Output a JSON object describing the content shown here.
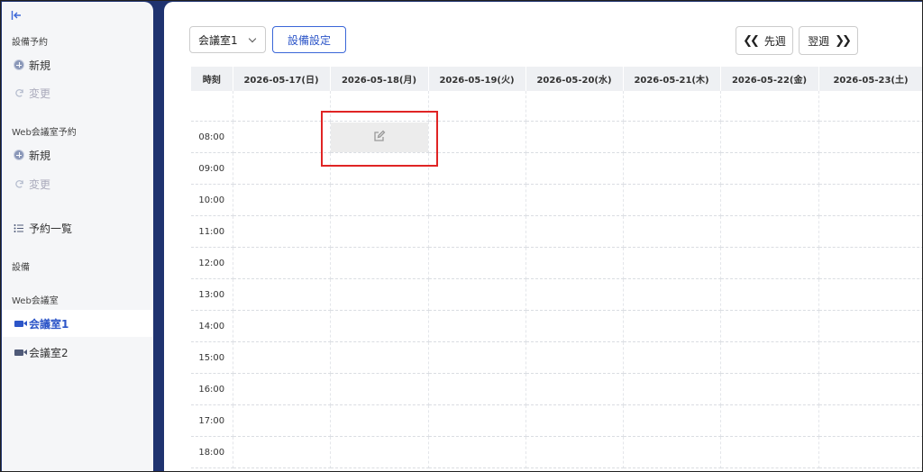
{
  "sidebar": {
    "facility_reservation_label": "設備予約",
    "facility_new": "新規",
    "facility_change": "変更",
    "web_reservation_label": "Web会議室予約",
    "web_new": "新規",
    "web_change": "変更",
    "reservation_list": "予約一覧",
    "facility_label": "設備",
    "web_room_label": "Web会議室",
    "rooms": [
      "会議室1",
      "会議室2"
    ],
    "active_room": "会議室1"
  },
  "toolbar": {
    "room_select_value": "会議室1",
    "settings_label": "設備設定",
    "prev_week_label": "先週",
    "next_week_label": "翌週"
  },
  "calendar": {
    "time_header": "時刻",
    "days": [
      "2026-05-17(日)",
      "2026-05-18(月)",
      "2026-05-19(火)",
      "2026-05-20(水)",
      "2026-05-21(木)",
      "2026-05-22(金)",
      "2026-05-23(土)"
    ],
    "times": [
      "",
      "08:00",
      "09:00",
      "10:00",
      "11:00",
      "12:00",
      "13:00",
      "14:00",
      "15:00",
      "16:00",
      "17:00",
      "18:00"
    ],
    "selected_slot": {
      "day": "2026-05-18(月)",
      "time": "08:00",
      "icon": "edit-icon"
    }
  },
  "colors": {
    "accent": "#2c55c8",
    "frame": "#1f3370",
    "highlight": "#e02424"
  }
}
